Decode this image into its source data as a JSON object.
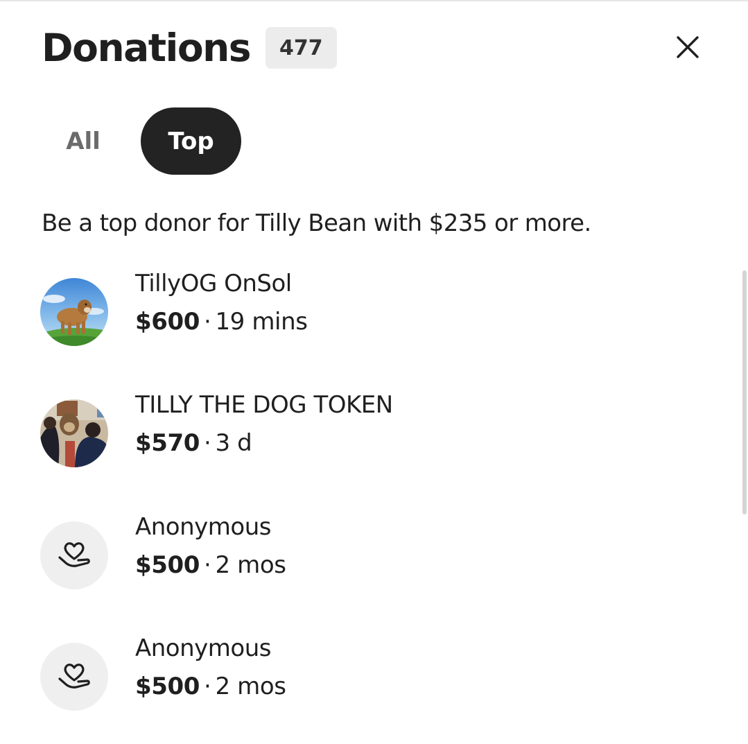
{
  "header": {
    "title": "Donations",
    "count": "477"
  },
  "tabs": [
    {
      "label": "All",
      "selected": false
    },
    {
      "label": "Top",
      "selected": true
    }
  ],
  "subtitle": "Be a top donor for Tilly Bean with $235 or more.",
  "donations": [
    {
      "name": "TillyOG OnSol",
      "amount": "$600",
      "separator": "·",
      "time": "19 mins",
      "avatar": "dog-photo-avatar"
    },
    {
      "name": "TILLY THE DOG TOKEN",
      "amount": "$570",
      "separator": "·",
      "time": "3 d",
      "avatar": "group-photo-avatar"
    },
    {
      "name": "Anonymous",
      "amount": "$500",
      "separator": "·",
      "time": "2 mos",
      "avatar": "heart-hand-icon"
    },
    {
      "name": "Anonymous",
      "amount": "$500",
      "separator": "·",
      "time": "2 mos",
      "avatar": "heart-hand-icon"
    }
  ],
  "colors": {
    "selected_tab_bg": "#232323",
    "badge_bg": "#ececec",
    "anon_avatar_bg": "#efefef"
  }
}
